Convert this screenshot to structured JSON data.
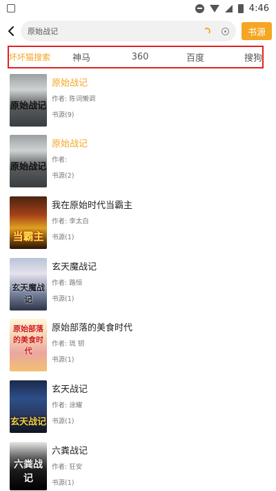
{
  "status_bar": {
    "time": "4:46",
    "icons": [
      "app-notification-icon",
      "do-not-disturb-icon",
      "wifi-icon",
      "signal-icon",
      "battery-icon"
    ]
  },
  "search": {
    "query": "原始战记",
    "source_button": "书源"
  },
  "tabs": [
    {
      "label": "坏坏猫搜索",
      "active": true
    },
    {
      "label": "神马",
      "active": false
    },
    {
      "label": "360",
      "active": false
    },
    {
      "label": "百度",
      "active": false
    },
    {
      "label": "搜狗",
      "active": false
    }
  ],
  "books": [
    {
      "title": "原始战记",
      "author": "作者: 陈词懒调",
      "sources": "书源(9)",
      "highlight": true,
      "cover_text": "原始战记"
    },
    {
      "title": "原始战记",
      "author": "作者:",
      "sources": "书源(2)",
      "highlight": true,
      "cover_text": "原始战记"
    },
    {
      "title": "我在原始时代当霸主",
      "author": "作者: 李太白",
      "sources": "书源(1)",
      "highlight": false,
      "cover_text": "当霸主"
    },
    {
      "title": "玄天魔战记",
      "author": "作者: 路恒",
      "sources": "书源(1)",
      "highlight": false,
      "cover_text": "玄天魔战记"
    },
    {
      "title": "原始部落的美食时代",
      "author": "作者: 琉 钥",
      "sources": "书源(1)",
      "highlight": false,
      "cover_text": "原始部落的美食时代"
    },
    {
      "title": "玄天战记",
      "author": "作者: 涂耀",
      "sources": "书源(1)",
      "highlight": false,
      "cover_text": "玄天战记"
    },
    {
      "title": "六粪战记",
      "author": "作者: 狂安",
      "sources": "书源(1)",
      "highlight": false,
      "cover_text": "六粪战记"
    }
  ],
  "colors": {
    "accent": "#f5a623",
    "highlight_frame": "#e02020"
  }
}
